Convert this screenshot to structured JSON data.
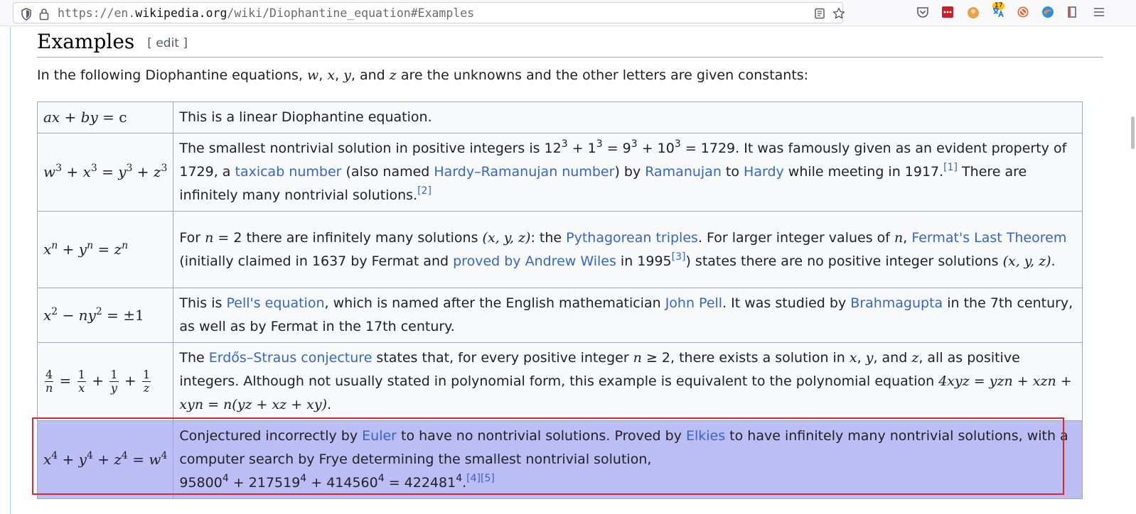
{
  "browser": {
    "url_prefix": "https://en.",
    "url_host": "wikipedia.org",
    "url_path": "/wiki/Diophantine_equation#Examples",
    "badge_count": "17"
  },
  "section": {
    "title": "Examples",
    "edit_label": "[ edit ]"
  },
  "intro": {
    "before": "In the following Diophantine equations, ",
    "v1": "w",
    "s1": ", ",
    "v2": "x",
    "s2": ", ",
    "v3": "y",
    "s3": ", and ",
    "v4": "z",
    "after": " are the unknowns and the other letters are given constants:"
  },
  "rows": {
    "r1": {
      "text": "This is a linear Diophantine equation."
    },
    "r2": {
      "t1": "The smallest nontrivial solution in positive integers is 12",
      "t2": " + 1",
      "t3": " = 9",
      "t4": " + 10",
      "t5": " = 1729. It was famously given as an evident property of 1729, a ",
      "link1": "taxicab number",
      "t6": " (also named ",
      "link2": "Hardy–Ramanujan number",
      "t7": ") by ",
      "link3": "Ramanujan",
      "t8": " to ",
      "link4": "Hardy",
      "t9": " while meeting in 1917.",
      "cite1": "[1]",
      "t10": " There are infinitely many nontrivial solutions.",
      "cite2": "[2]"
    },
    "r3": {
      "t1": "For ",
      "t2": " = 2 there are infinitely many solutions ",
      "triple": "(x, y, z)",
      "t3": ": the ",
      "link1": "Pythagorean triples",
      "t4": ". For larger integer values of ",
      "t5": ", ",
      "link2": "Fermat's Last Theorem",
      "t6": " (initially claimed in 1637 by Fermat and ",
      "link3": "proved by Andrew Wiles",
      "t7": " in 1995",
      "cite1": "[3]",
      "t8": ") states there are no positive integer solutions ",
      "t9": "."
    },
    "r4": {
      "t1": "This is ",
      "link1": "Pell's equation",
      "t2": ", which is named after the English mathematician ",
      "link2": "John Pell",
      "t3": ". It was studied by ",
      "link3": "Brahmagupta",
      "t4": " in the 7th century, as well as by Fermat in the 17th century."
    },
    "r5": {
      "t1": "The ",
      "link1": "Erdős–Straus conjecture",
      "t2": " states that, for every positive integer ",
      "ineq": " ≥ 2",
      "t3": ", there exists a solution in ",
      "t4": ", ",
      "t5": ", and ",
      "t6": ", all as positive integers. Although not usually stated in polynomial form, this example is equivalent to the polynomial equation ",
      "poly": "4xyz = yzn + xzn + xyn = n(yz + xz + xy)",
      "t7": "."
    },
    "r6": {
      "t1": "Conjectured incorrectly by ",
      "link1": "Euler",
      "t2": " to have no nontrivial solutions. Proved by ",
      "link2": "Elkies",
      "t3": " to have infinitely many nontrivial solutions, with a computer search by Frye determining the smallest nontrivial solution,",
      "n1": "95800",
      "n2": " + 217519",
      "n3": " + 414560",
      "n4": " = 422481",
      "t4": ".",
      "cite1": "[4]",
      "cite2": "[5]"
    }
  },
  "colors": {
    "link": "#3366cc",
    "highlight": "#bdbdf5",
    "highlight_border": "#e0262e"
  }
}
